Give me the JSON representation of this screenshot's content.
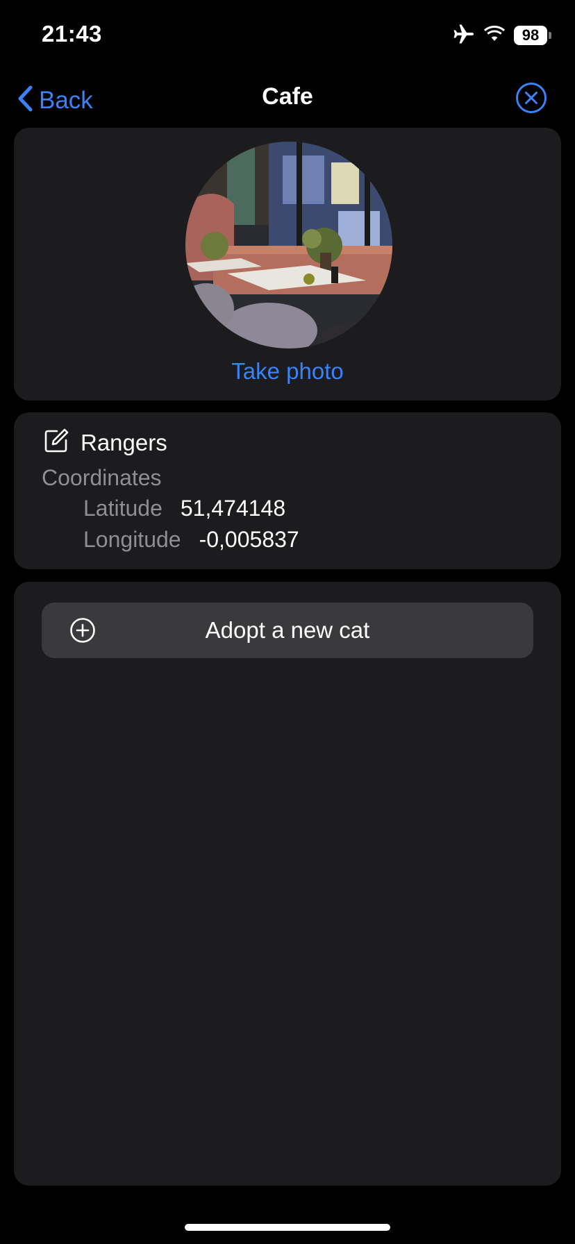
{
  "status_bar": {
    "time": "21:43",
    "battery": "98",
    "icons": [
      "airplane-icon",
      "wifi-icon",
      "battery-icon"
    ]
  },
  "nav": {
    "back_label": "Back",
    "title": "Cafe",
    "close_icon": "close-circle-icon"
  },
  "photo_card": {
    "take_photo_label": "Take photo"
  },
  "info_card": {
    "name": "Rangers",
    "coordinates_label": "Coordinates",
    "latitude_label": "Latitude",
    "latitude_value": "51,474148",
    "longitude_label": "Longitude",
    "longitude_value": "-0,005837"
  },
  "list_card": {
    "adopt_label": "Adopt a new cat"
  },
  "colors": {
    "accent": "#3a82f7",
    "background": "#000000",
    "card": "#1c1c1e",
    "button": "#3a3a3c",
    "secondary_text": "#8e8e93"
  }
}
